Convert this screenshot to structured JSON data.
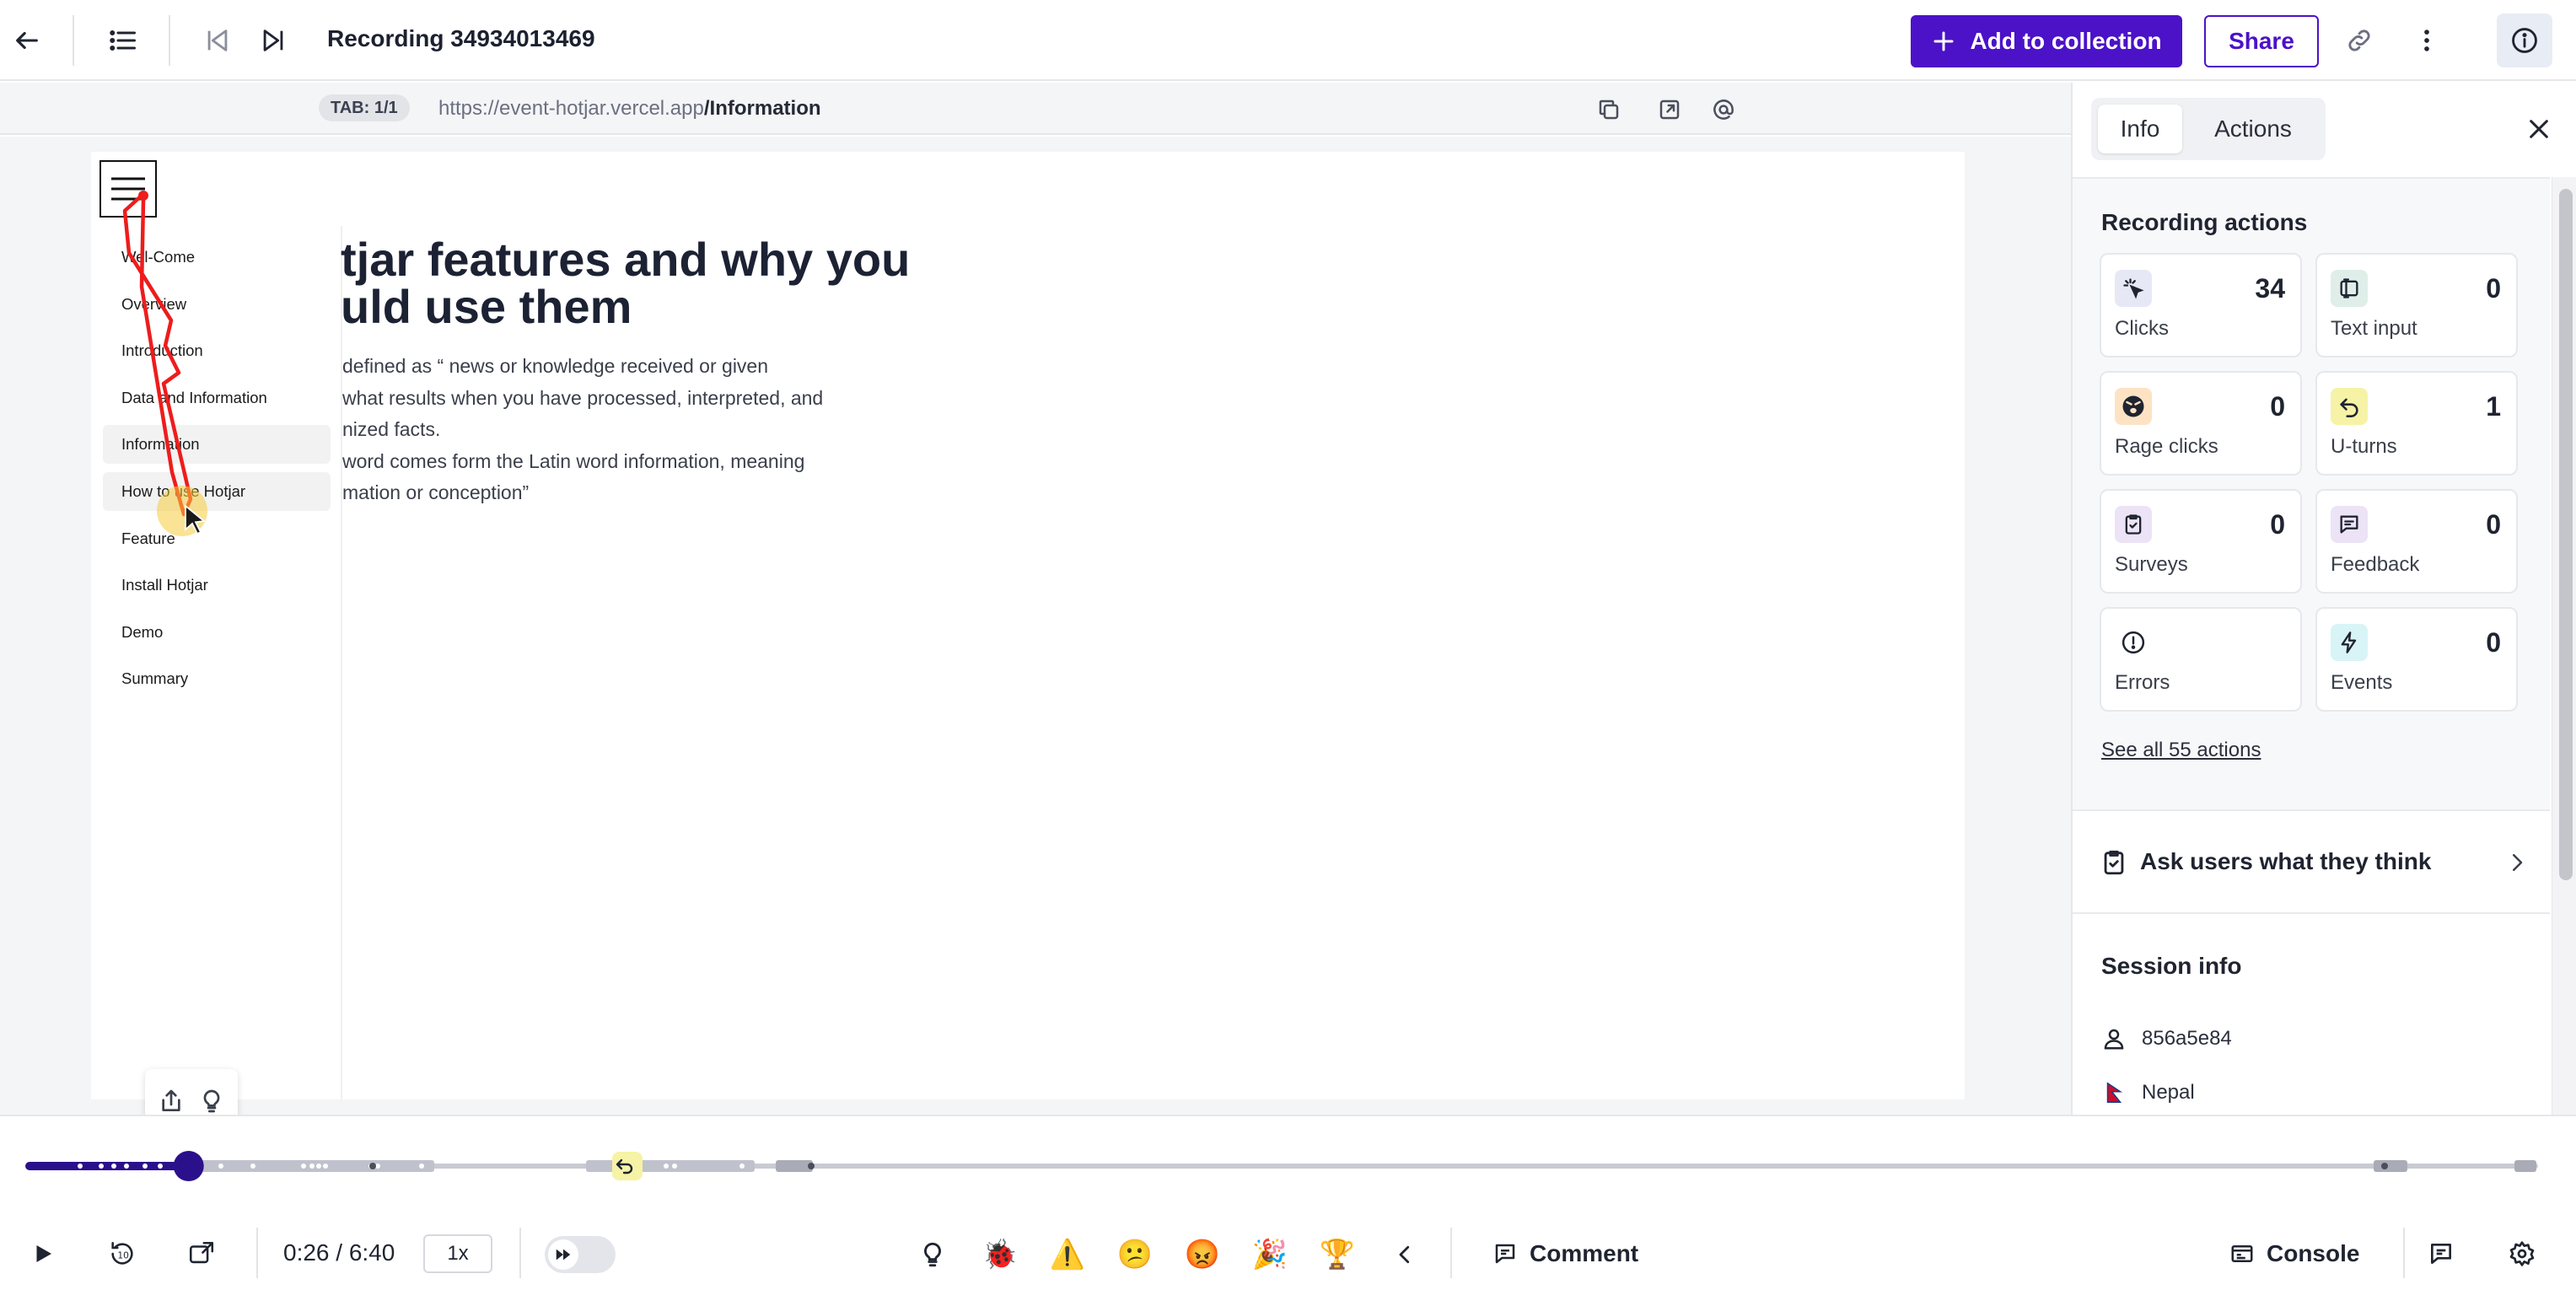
{
  "header": {
    "title": "Recording 34934013469",
    "add_label": "Add to collection",
    "share_label": "Share"
  },
  "urlbar": {
    "tab_badge": "TAB: 1/1",
    "url_base": "https://event-hotjar.vercel.app",
    "url_path": "/Information"
  },
  "page": {
    "nav": [
      "Wel-Come",
      "Overview",
      "Introduction",
      "Data and Information",
      "Information",
      "How to use Hotjar",
      "Feature",
      "Install Hotjar",
      "Demo",
      "Summary"
    ],
    "headline_line1": "tjar features and why you",
    "headline_line2": "uld use them",
    "para_lines": [
      "defined as “ news or knowledge received or given",
      "what results when you have processed, interpreted, and",
      "nized facts.",
      "word comes form the Latin word information, meaning",
      "mation or conception”"
    ]
  },
  "panel": {
    "tabs": [
      "Info",
      "Actions"
    ],
    "active_tab": "Info",
    "section_title": "Recording actions",
    "cards": [
      {
        "label": "Clicks",
        "count": "34",
        "icon": "click-icon",
        "tint": "#e6e9f5"
      },
      {
        "label": "Text input",
        "count": "0",
        "icon": "text-input-icon",
        "tint": "#dfeee9"
      },
      {
        "label": "Rage clicks",
        "count": "0",
        "icon": "rage-face-icon",
        "tint": "#fde3c4"
      },
      {
        "label": "U-turns",
        "count": "1",
        "icon": "u-turn-icon",
        "tint": "#f6f3a6"
      },
      {
        "label": "Surveys",
        "count": "0",
        "icon": "survey-icon",
        "tint": "#ece3f6"
      },
      {
        "label": "Feedback",
        "count": "0",
        "icon": "feedback-icon",
        "tint": "#ece3f6"
      },
      {
        "label": "Errors",
        "count": "",
        "icon": "error-icon",
        "tint": "#ffffff"
      },
      {
        "label": "Events",
        "count": "0",
        "icon": "lightning-icon",
        "tint": "#d8f4f7"
      }
    ],
    "see_all": "See all 55 actions",
    "ask_label": "Ask users what they think",
    "session_title": "Session info",
    "session_user": "856a5e84",
    "session_country": "Nepal"
  },
  "player": {
    "current_time": "0:26",
    "total_time": "6:40",
    "time_display": "0:26 / 6:40",
    "progress": 0.065,
    "speed": "1x",
    "emoji_reactions": [
      "💡",
      "🐞",
      "⚠️",
      "😕",
      "😡",
      "🎉",
      "🏆"
    ],
    "comment_label": "Comment",
    "console_label": "Console"
  },
  "colors": {
    "brand": "#4b12c8",
    "timeline_played": "#2b108c",
    "timeline_rest": "#c9cbd2",
    "trail": "#ee1c1c"
  }
}
